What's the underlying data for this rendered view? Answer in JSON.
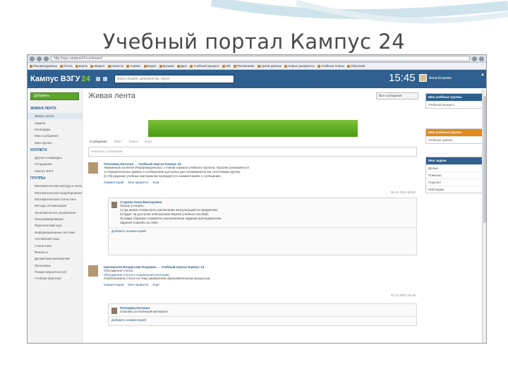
{
  "slide": {
    "title": "Учебный портал Кампус 24"
  },
  "browser": {
    "url": "http://vgu.campus24.ru/stream/",
    "bookmarks": [
      "Рекомендуемые",
      "Почта",
      "Карты",
      "Маркет",
      "Новости",
      "Сервис",
      "Видео",
      "Музыка",
      "Диск",
      "Учебный процесс",
      "MS",
      "Расписание",
      "Архив данных",
      "Новые документы",
      "Учебные планы",
      "Обучение"
    ]
  },
  "header": {
    "logo": "Кампус ВЗГУ",
    "logo_num": "24",
    "search_placeholder": "поиск людей, документов, групп",
    "clock": "15:45",
    "user_name": "Анна Егорова"
  },
  "sidebar": {
    "add_button": "Добавить",
    "sections": [
      {
        "title": "ЖИВАЯ ЛЕНТА",
        "items": [
          "Живая лента",
          "Задачи",
          "Календарь",
          "Мои сообщения",
          "Мои группы"
        ]
      },
      {
        "title": "КОЛЛЕГИ",
        "items": [
          "Друзья и кафедры",
          "Сотрудники",
          "Кампус ВЗГУ"
        ]
      },
      {
        "title": "ГРУППЫ",
        "items": [
          "Математические методы в экономике",
          "Математическое моделирование",
          "Математическая статистика",
          "Методы оптимизации",
          "Экономическое управление",
          "Программирование",
          "Практический курс",
          "Информационные системы",
          "Английский язык",
          "Статистика",
          "Финансы",
          "Дискретная математика",
          "Экономика",
          "Теория вероятностей",
          "Учебная практика"
        ]
      }
    ]
  },
  "feed": {
    "title": "Живая лента",
    "filter": "Все сообщения",
    "tabs": [
      "Сообщение",
      "Файл",
      "Опрос",
      "Ещё"
    ],
    "compose_placeholder": "Написать сообщение",
    "posts": [
      {
        "author": "Поплавец Наталья → Учебный портал Кампус 24",
        "lines": [
          "Уважаемые коллеги! Информируем вас о новом сервисе учебного портала. Просим ознакомиться.",
          "1) Прикрепленные файлы к сообщениям доступны для скачивания всем участникам группы.",
          "2) Обсуждение учебных материалов проводится в комментариях к сообщению."
        ],
        "actions": [
          "Комментарий",
          "Мне нравится",
          "Ещё"
        ],
        "date": "06.12.2013 09:32",
        "comment": {
          "author": "Старова Анна Викторовна",
          "lines": [
            "Прошу уточнить:",
            "1) где можно посмотреть расписание консультаций по предметам;",
            "2) будет ли доступна электронная версия учебных пособий;",
            "3) каким образом отправлять выполненные задания преподавателю.",
            "Заранее спасибо за ответ."
          ],
          "foot": "Добавить комментарий"
        }
      },
      {
        "author": "Шаповалов Владислав Игоревич → Учебный портал Кампус 24",
        "lines": [
          "Обсуждение статьи.",
          "Опубликована статья на тему управления образовательным процессом."
        ],
        "link": "Обсуждение статьи в социальной категории",
        "date": "07.12.2013 10:15",
        "actions": [
          "Комментарий",
          "Мне нравится",
          "Ещё"
        ],
        "comment": {
          "author": "Поплавец Наталья",
          "lines": [
            "Спасибо за полезный материал!"
          ],
          "foot": "Добавить комментарий"
        }
      }
    ]
  },
  "right": {
    "panels": [
      {
        "title": "Мои учебные группы",
        "color": "#2e5f8f",
        "rows": [
          "Учебный процесс"
        ]
      },
      {
        "title": "Мои учебные группы",
        "color": "#e08a1f",
        "rows": [
          "Учебные группы"
        ]
      },
      {
        "title": "Мои задачи",
        "color": "#2e5f8f",
        "rows": [
          "Делаю",
          "Помогаю",
          "Поручил",
          "Наблюдаю"
        ]
      }
    ]
  }
}
